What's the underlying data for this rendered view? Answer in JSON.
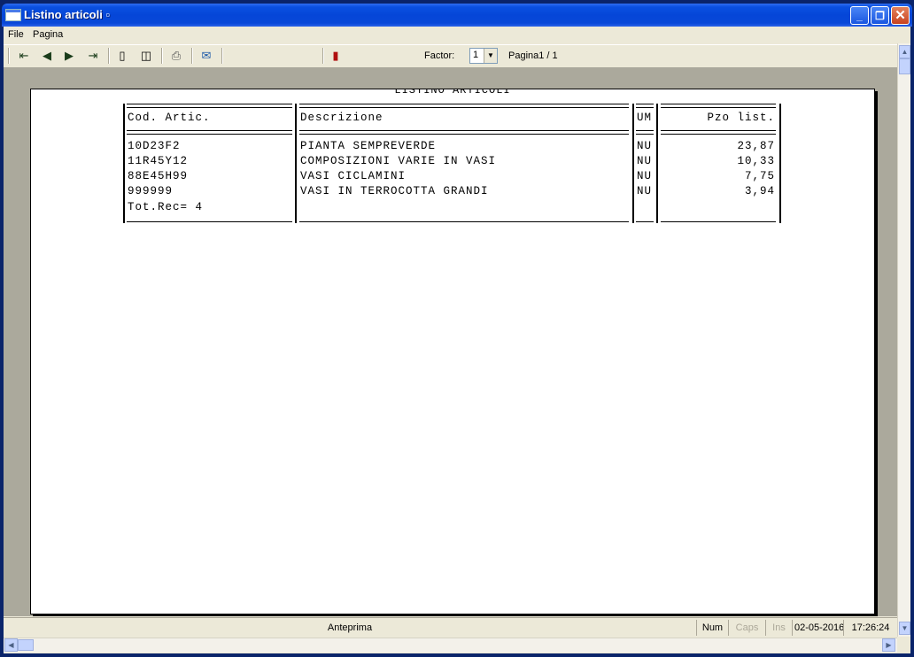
{
  "window": {
    "title": "Listino articoli",
    "title_suffix": "▫",
    "controls": {
      "minimize": "_",
      "maximize": "❐",
      "close": "✕"
    }
  },
  "menubar": {
    "items": [
      "File",
      "Pagina"
    ]
  },
  "toolbar": {
    "buttons": [
      "first-page-icon",
      "prev-page-icon",
      "next-page-icon",
      "last-page-icon",
      "single-page-icon",
      "two-pages-icon",
      "print-icon",
      "export-icon",
      "exit-icon"
    ],
    "factor_label": "Factor:",
    "factor_value": "1",
    "page_info": "Pagina1 / 1"
  },
  "report": {
    "title": "LISTINO ARTICOLI",
    "columns": [
      "Cod. Artic.",
      "Descrizione",
      "UM",
      "Pzo list."
    ],
    "rows": [
      {
        "code": "10D23F2",
        "description": "PIANTA SEMPREVERDE",
        "um": "NU",
        "price": "23,87"
      },
      {
        "code": "11R45Y12",
        "description": "COMPOSIZIONI VARIE IN VASI",
        "um": "NU",
        "price": "10,33"
      },
      {
        "code": "88E45H99",
        "description": "VASI CICLAMINI",
        "um": "NU",
        "price": "7,75"
      },
      {
        "code": "999999",
        "description": "VASI IN TERROCOTTA GRANDI",
        "um": "NU",
        "price": "3,94"
      }
    ],
    "total": "Tot.Rec= 4"
  },
  "statusbar": {
    "mode": "Anteprima",
    "num": "Num",
    "caps": "Caps",
    "ins": "Ins",
    "date": "02-05-2016",
    "time": "17:26:24"
  },
  "colors": {
    "titlebar": "#0546d8",
    "client": "#ece9d8",
    "preview_bg": "#aba99c"
  }
}
